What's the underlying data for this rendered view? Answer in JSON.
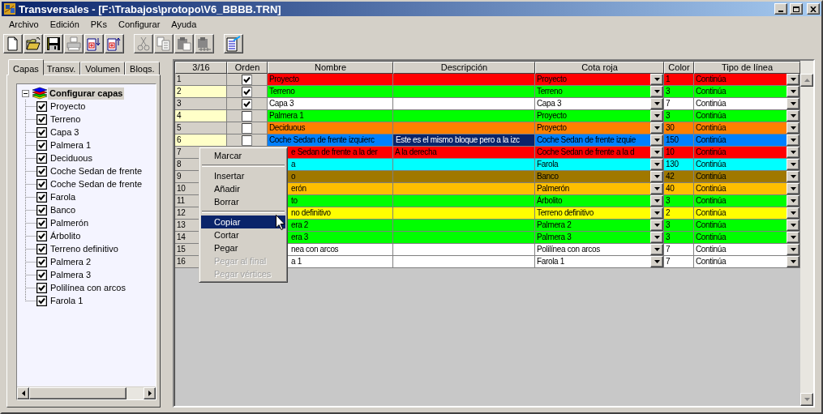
{
  "window": {
    "title": "Transversales - [F:\\Trabajos\\protopo\\V6_BBBB.TRN]"
  },
  "menu": [
    "Archivo",
    "Edición",
    "PKs",
    "Configurar",
    "Ayuda"
  ],
  "toolbar": [
    {
      "kind": "new",
      "disabled": false
    },
    {
      "kind": "open",
      "disabled": false
    },
    {
      "kind": "save",
      "disabled": false
    },
    {
      "kind": "print",
      "disabled": true
    },
    {
      "kind": "export",
      "disabled": false
    },
    {
      "kind": "import",
      "disabled": false
    },
    {
      "kind": "separator"
    },
    {
      "kind": "cut",
      "disabled": true
    },
    {
      "kind": "copy",
      "disabled": true
    },
    {
      "kind": "paste",
      "disabled": true
    },
    {
      "kind": "paste-special",
      "disabled": true
    },
    {
      "kind": "separator"
    },
    {
      "kind": "properties",
      "disabled": false
    }
  ],
  "tabs": [
    {
      "label": "Capas",
      "selected": true
    },
    {
      "label": "Transv.",
      "selected": false
    },
    {
      "label": "Volumen",
      "selected": false
    },
    {
      "label": "Bloqs.",
      "selected": false
    }
  ],
  "tree": {
    "label": "Configurar capas",
    "expanded": true,
    "selected": true,
    "children": [
      {
        "label": "Proyecto",
        "checked": true,
        "selected": false
      },
      {
        "label": "Terreno",
        "checked": true,
        "selected": false
      },
      {
        "label": "Capa 3",
        "checked": true,
        "selected": false
      },
      {
        "label": "Palmera 1",
        "checked": true,
        "selected": false
      },
      {
        "label": "Deciduous",
        "checked": true,
        "selected": false
      },
      {
        "label": "Coche Sedan de frente",
        "checked": true,
        "selected": false
      },
      {
        "label": "Coche Sedan de frente",
        "checked": true,
        "selected": false
      },
      {
        "label": "Farola",
        "checked": true,
        "selected": false
      },
      {
        "label": "Banco",
        "checked": true,
        "selected": false
      },
      {
        "label": "Palmerón",
        "checked": true,
        "selected": false
      },
      {
        "label": "Árbolito",
        "checked": true,
        "selected": false
      },
      {
        "label": "Terreno definitivo",
        "checked": true,
        "selected": false
      },
      {
        "label": "Palmera 2",
        "checked": true,
        "selected": false
      },
      {
        "label": "Palmera 3",
        "checked": true,
        "selected": false
      },
      {
        "label": "Polilínea con arcos",
        "checked": true,
        "selected": false
      },
      {
        "label": "Farola 1",
        "checked": true,
        "selected": false
      }
    ]
  },
  "grid": {
    "counter": "3/16",
    "columns": [
      "Orden",
      "Nombre",
      "Descripción",
      "Cota roja",
      "Color",
      "Tipo de línea"
    ],
    "rows": [
      {
        "number": "1",
        "highlighted": false,
        "orden": true,
        "name": "Proyecto",
        "name_covered": false,
        "color": "#ff0000",
        "cota_roja": "Proyecto",
        "color_code": "1",
        "line_type": "Continúa"
      },
      {
        "number": "2",
        "highlighted": true,
        "orden": true,
        "name": "Terreno",
        "name_covered": false,
        "color": "#00ff00",
        "cota_roja": "Terreno",
        "color_code": "3",
        "line_type": "Continúa"
      },
      {
        "number": "3",
        "highlighted": false,
        "orden": true,
        "name": "Capa 3",
        "name_covered": false,
        "color": "#ffffff",
        "cota_roja": "Capa 3",
        "color_code": "7",
        "line_type": "Continúa"
      },
      {
        "number": "4",
        "highlighted": true,
        "orden": false,
        "name": "Palmera 1",
        "name_covered": false,
        "color": "#00ff00",
        "cota_roja": "Proyecto",
        "color_code": "3",
        "line_type": "Continúa"
      },
      {
        "number": "5",
        "highlighted": false,
        "orden": false,
        "name": "Deciduous",
        "name_covered": false,
        "color": "#ff8000",
        "cota_roja": "Proyecto",
        "color_code": "30",
        "line_type": "Continúa"
      },
      {
        "number": "6",
        "highlighted": true,
        "orden": false,
        "name": "Coche Sedan de frente izquierc",
        "name_covered": false,
        "color": "#0080ff",
        "description": "Este es el mismo bloque pero a la izc",
        "description_selected": true,
        "cota_roja": "Coche Sedan de frente izquie",
        "color_code": "150",
        "line_type": "Continúa"
      },
      {
        "number": "7",
        "highlighted": false,
        "name": "e Sedan de frente a la der",
        "name_covered": true,
        "color": "#ff0000",
        "description": "A la derecha",
        "description_selected": false,
        "cota_roja": "Coche Sedan de frente a la d",
        "color_code": "10",
        "line_type": "Continúa"
      },
      {
        "number": "8",
        "highlighted": false,
        "name": "a",
        "name_covered": true,
        "color": "#00ffff",
        "cota_roja": "Farola",
        "color_code": "130",
        "line_type": "Continúa"
      },
      {
        "number": "9",
        "highlighted": false,
        "name": "o",
        "name_covered": true,
        "color": "#a07800",
        "cota_roja": "Banco",
        "color_code": "42",
        "line_type": "Continúa"
      },
      {
        "number": "10",
        "highlighted": false,
        "name": "erón",
        "name_covered": true,
        "color": "#ffbf00",
        "cota_roja": "Palmerón",
        "color_code": "40",
        "line_type": "Continúa"
      },
      {
        "number": "11",
        "highlighted": false,
        "name": "to",
        "name_covered": true,
        "color": "#00ff00",
        "cota_roja": "Árbolito",
        "color_code": "3",
        "line_type": "Continúa"
      },
      {
        "number": "12",
        "highlighted": false,
        "name": "no definitivo",
        "name_covered": true,
        "color": "#ffff00",
        "cota_roja": "Terreno definitivo",
        "color_code": "2",
        "line_type": "Continúa"
      },
      {
        "number": "13",
        "highlighted": false,
        "name": "era 2",
        "name_covered": true,
        "color": "#00ff00",
        "cota_roja": "Palmera 2",
        "color_code": "3",
        "line_type": "Continúa"
      },
      {
        "number": "14",
        "highlighted": false,
        "name": "era 3",
        "name_covered": true,
        "color": "#00ff00",
        "cota_roja": "Palmera 3",
        "color_code": "3",
        "line_type": "Continúa"
      },
      {
        "number": "15",
        "highlighted": false,
        "name": "nea con arcos",
        "name_covered": true,
        "color": "#ffffff",
        "cota_roja": "Polilínea con arcos",
        "color_code": "7",
        "line_type": "Continúa"
      },
      {
        "number": "16",
        "highlighted": false,
        "name": "a 1",
        "name_covered": true,
        "color": "#ffffff",
        "cota_roja": "Farola 1",
        "color_code": "7",
        "line_type": "Continúa"
      }
    ]
  },
  "context_menu": [
    {
      "kind": "item",
      "label": "Marcar",
      "selected": false,
      "disabled": false
    },
    {
      "kind": "separator"
    },
    {
      "kind": "item",
      "label": "Insertar",
      "selected": false,
      "disabled": false
    },
    {
      "kind": "item",
      "label": "Añadir",
      "selected": false,
      "disabled": false
    },
    {
      "kind": "item",
      "label": "Borrar",
      "selected": false,
      "disabled": false
    },
    {
      "kind": "separator"
    },
    {
      "kind": "item",
      "label": "Copiar",
      "selected": true,
      "disabled": false
    },
    {
      "kind": "item",
      "label": "Cortar",
      "selected": false,
      "disabled": false
    },
    {
      "kind": "item",
      "label": "Pegar",
      "selected": false,
      "disabled": false
    },
    {
      "kind": "item",
      "label": "Pegar al final",
      "selected": false,
      "disabled": true
    },
    {
      "kind": "item",
      "label": "Pegar vértices",
      "selected": false,
      "disabled": true
    }
  ]
}
